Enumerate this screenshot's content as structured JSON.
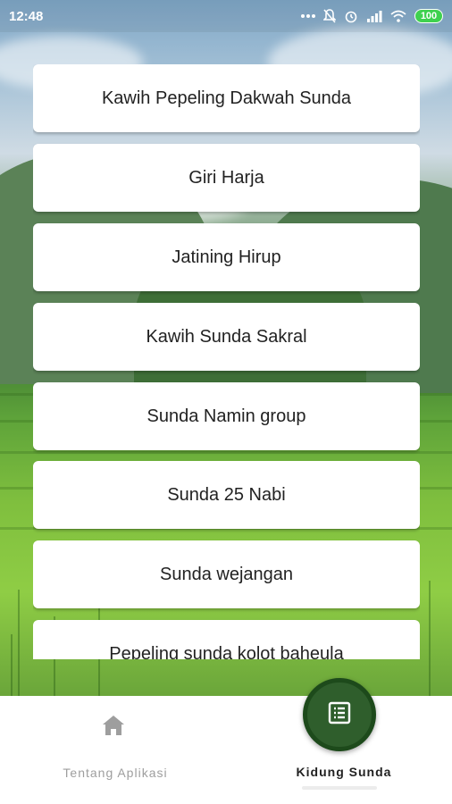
{
  "status_bar": {
    "time": "12:48",
    "battery": "100",
    "icons": [
      "more-dots-icon",
      "bell-off-icon",
      "alarm-icon",
      "signal-icon",
      "wifi-icon"
    ]
  },
  "songs": [
    {
      "title": "Kawih Pepeling Dakwah Sunda"
    },
    {
      "title": "Giri Harja"
    },
    {
      "title": "Jatining Hirup"
    },
    {
      "title": "Kawih Sunda Sakral"
    },
    {
      "title": "Sunda Namin group"
    },
    {
      "title": "Sunda 25 Nabi"
    },
    {
      "title": "Sunda wejangan"
    },
    {
      "title": "Pepeling sunda kolot baheula"
    }
  ],
  "bottom_nav": {
    "items": [
      {
        "label": "Tentang Aplikasi",
        "icon": "home-icon",
        "active": false
      },
      {
        "label": "Kidung Sunda",
        "icon": "list-icon",
        "active": true
      }
    ]
  },
  "colors": {
    "accent": "#2f5e2c",
    "inactive_label": "#9e9e9e",
    "battery": "#3fd14f"
  }
}
